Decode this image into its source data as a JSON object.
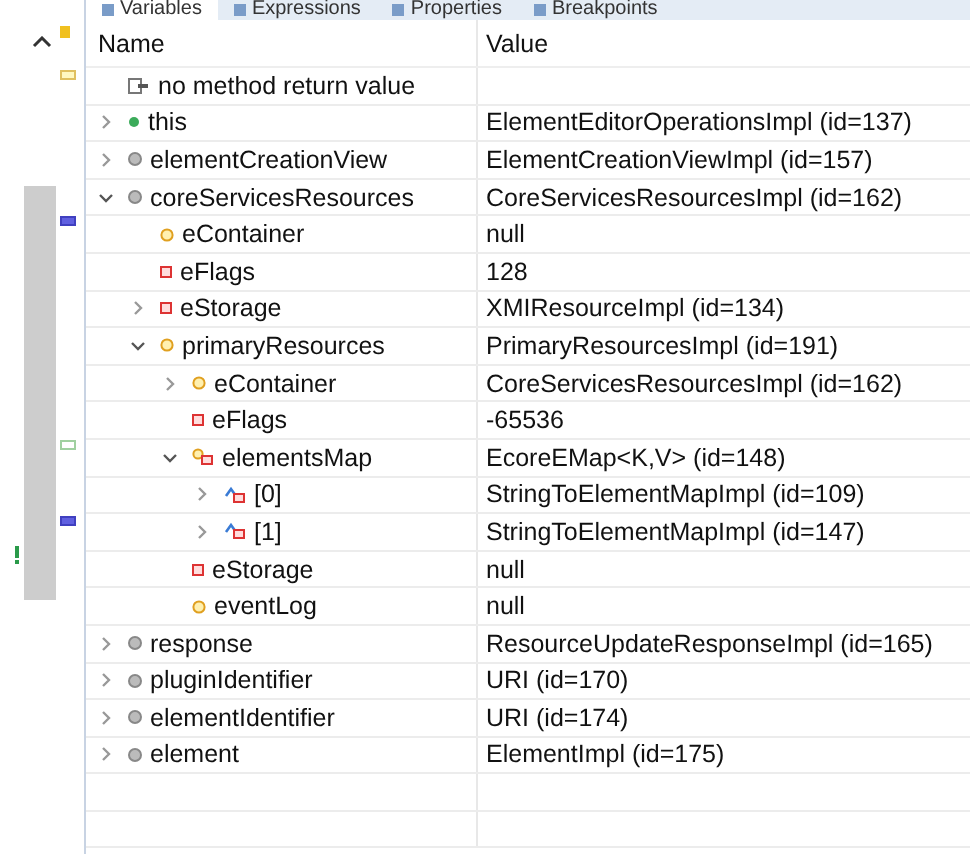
{
  "tabs": [
    {
      "label": "Variables",
      "selected": true
    },
    {
      "label": "Expressions",
      "selected": false
    },
    {
      "label": "Properties",
      "selected": false
    },
    {
      "label": "Breakpoints",
      "selected": false
    }
  ],
  "table": {
    "columns": [
      "Name",
      "Value"
    ],
    "rows": [
      {
        "name": "no method return value",
        "kind": "return"
      },
      {
        "name": "this",
        "kind": "local",
        "expanded": false,
        "value": "ElementEditorOperationsImpl  (id=137)"
      },
      {
        "name": "elementCreationView",
        "kind": "field",
        "expanded": false,
        "value": "ElementCreationViewImpl  (id=157)"
      },
      {
        "name": "coreServicesResources",
        "kind": "field",
        "expanded": true,
        "value": "CoreServicesResourcesImpl  (id=162)",
        "children": [
          {
            "name": "eContainer",
            "kind": "protected",
            "value": "null"
          },
          {
            "name": "eFlags",
            "kind": "private",
            "value": "128"
          },
          {
            "name": "eStorage",
            "kind": "private",
            "expanded": false,
            "value": "XMIResourceImpl  (id=134)"
          },
          {
            "name": "primaryResources",
            "kind": "protected",
            "expanded": true,
            "value": "PrimaryResourcesImpl  (id=191)",
            "children": [
              {
                "name": "eContainer",
                "kind": "protected",
                "expanded": false,
                "value": "CoreServicesResourcesImpl  (id=162)"
              },
              {
                "name": "eFlags",
                "kind": "private",
                "value": "-65536"
              },
              {
                "name": "elementsMap",
                "kind": "map",
                "expanded": true,
                "value": "EcoreEMap<K,V>  (id=148)",
                "children": [
                  {
                    "name": "[0]",
                    "kind": "entry",
                    "expanded": false,
                    "value": "StringToElementMapImpl  (id=109)"
                  },
                  {
                    "name": "[1]",
                    "kind": "entry",
                    "expanded": false,
                    "value": "StringToElementMapImpl  (id=147)"
                  }
                ]
              },
              {
                "name": "eStorage",
                "kind": "private",
                "value": "null"
              },
              {
                "name": "eventLog",
                "kind": "protected",
                "value": "null"
              }
            ]
          }
        ]
      },
      {
        "name": "response",
        "kind": "field",
        "expanded": false,
        "value": "ResourceUpdateResponseImpl  (id=165)"
      },
      {
        "name": "pluginIdentifier",
        "kind": "field",
        "expanded": false,
        "value": "URI  (id=170)"
      },
      {
        "name": "elementIdentifier",
        "kind": "field",
        "expanded": false,
        "value": "URI  (id=174)"
      },
      {
        "name": "element",
        "kind": "field",
        "expanded": false,
        "value": "ElementImpl  (id=175)"
      }
    ]
  }
}
